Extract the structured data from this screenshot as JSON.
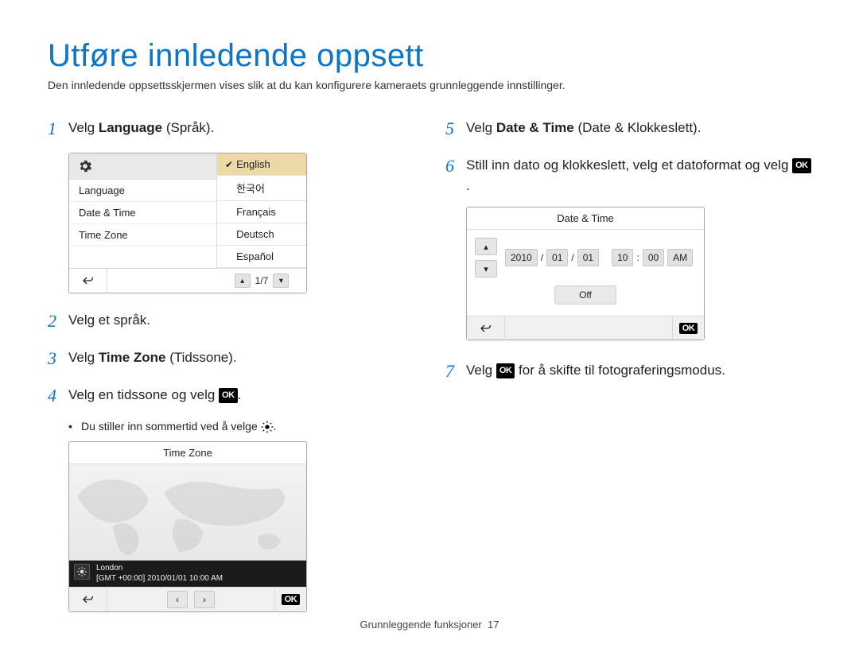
{
  "title": "Utføre innledende oppsett",
  "intro": "Den innledende oppsettsskjermen vises slik at du kan konfigurere kameraets grunnleggende innstillinger.",
  "steps": {
    "s1": {
      "num": "1",
      "pre": "Velg ",
      "bold": "Language",
      "post": " (Språk)."
    },
    "s2": {
      "num": "2",
      "text": "Velg et språk."
    },
    "s3": {
      "num": "3",
      "pre": "Velg ",
      "bold": "Time Zone",
      "post": " (Tidssone)."
    },
    "s4": {
      "num": "4",
      "pre": "Velg en tidssone og velg ",
      "ok": "OK",
      "post": "."
    },
    "s4_sub": {
      "text": "Du stiller inn sommertid ved å velge ",
      "icon": "sun",
      "post": "."
    },
    "s5": {
      "num": "5",
      "pre": "Velg ",
      "bold": "Date & Time",
      "post": " (Date & Klokkeslett)."
    },
    "s6": {
      "num": "6",
      "pre": "Still inn dato og klokkeslett, velg et datoformat og velg ",
      "ok": "OK",
      "post": "."
    },
    "s7": {
      "num": "7",
      "pre": "Velg ",
      "ok": "OK",
      "post": " for å skifte til fotograferingsmodus."
    }
  },
  "lang_panel": {
    "left_items": [
      "Language",
      "Date & Time",
      "Time Zone"
    ],
    "right_items": [
      "English",
      "한국어",
      "Français",
      "Deutsch",
      "Español"
    ],
    "selected_index": 0,
    "page": "1/7"
  },
  "tz_panel": {
    "title": "Time Zone",
    "city": "London",
    "gmt_line": "[GMT +00:00] 2010/01/01 10:00 AM"
  },
  "dt_panel": {
    "title": "Date & Time",
    "year": "2010",
    "month": "01",
    "day": "01",
    "hour": "10",
    "minute": "00",
    "ampm": "AM",
    "date_sep": "/",
    "time_sep": ":",
    "off_label": "Off"
  },
  "footer": {
    "section": "Grunnleggende funksjoner",
    "page_number": "17"
  },
  "ok_label": "OK"
}
